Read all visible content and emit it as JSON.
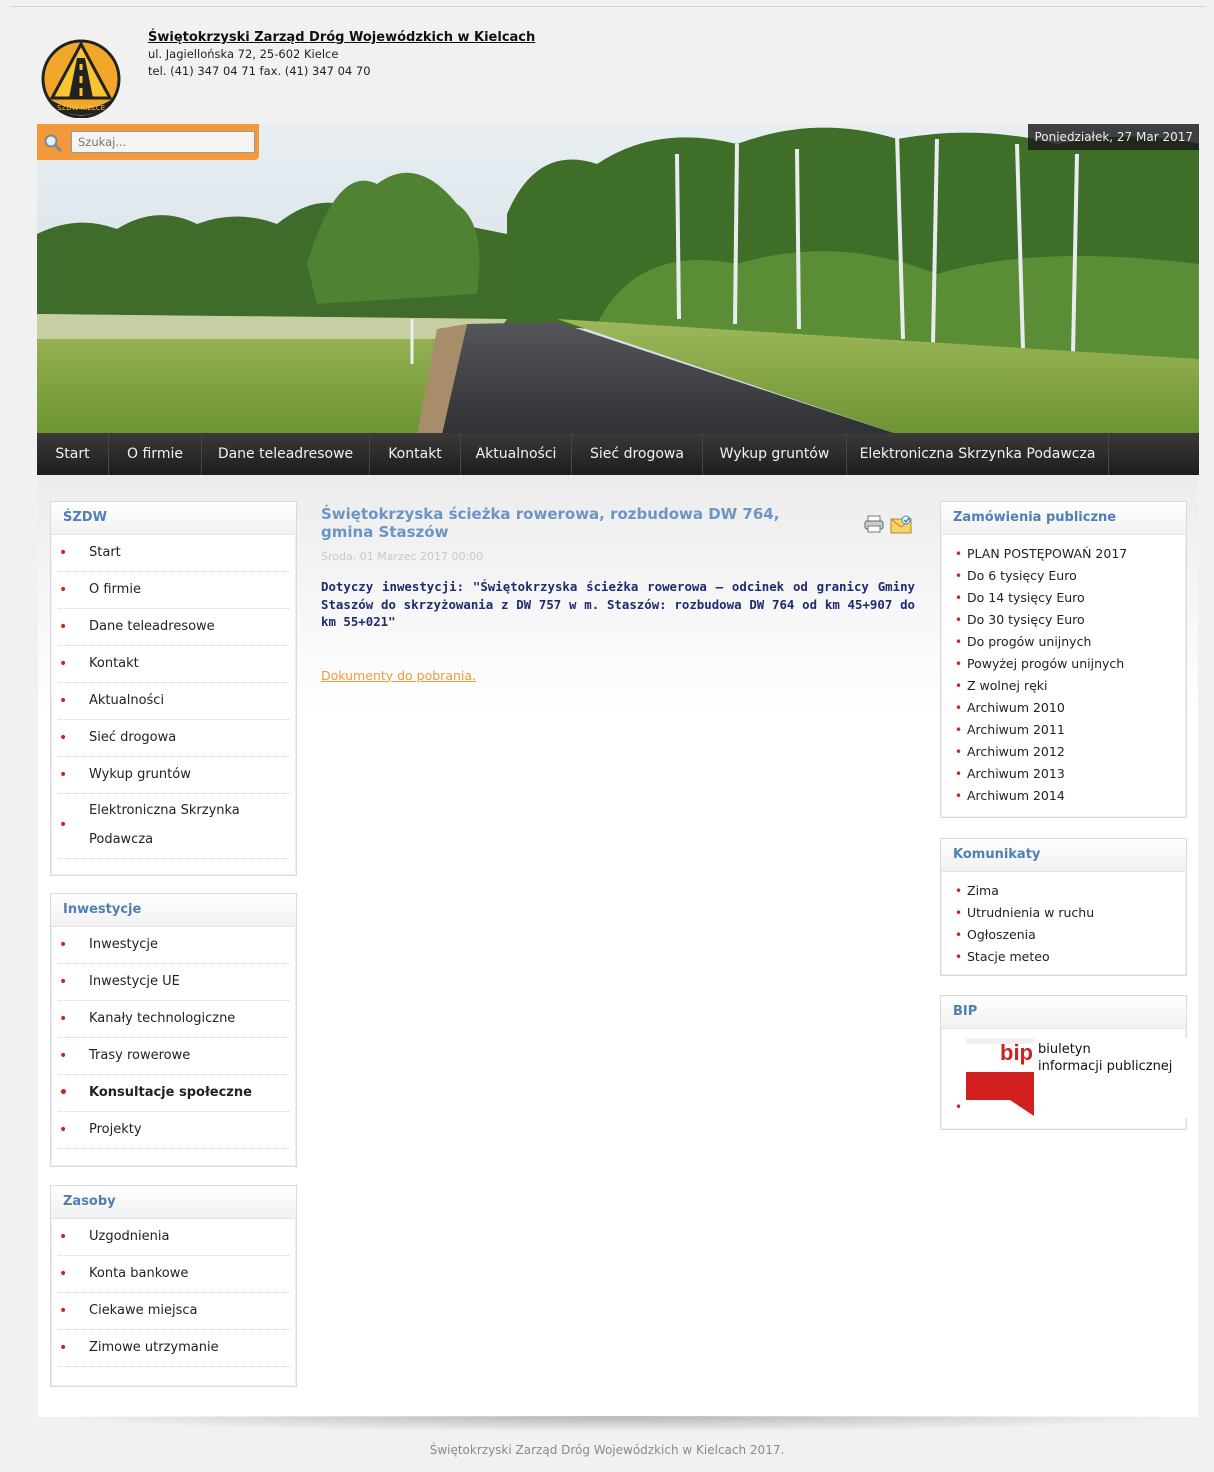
{
  "header": {
    "company_name": "Świętokrzyski Zarząd Dróg Wojewódzkich w Kielcach",
    "address": "ul. Jagiellońska 72, 25-602 Kielce",
    "phone": "tel. (41) 347 04 71 fax. (41) 347 04 70",
    "logo_text": "ŚZDW KIELCE"
  },
  "search": {
    "placeholder": "Szukaj..."
  },
  "date": "Poniedziałek, 27 Mar 2017",
  "nav": [
    "Start",
    "O firmie",
    "Dane teleadresowe",
    "Kontakt",
    "Aktualności",
    "Sieć drogowa",
    "Wykup gruntów",
    "Elektroniczna Skrzynka Podawcza"
  ],
  "left": {
    "szdw": {
      "title": "ŚZDW",
      "items": [
        "Start",
        "O firmie",
        "Dane teleadresowe",
        "Kontakt",
        "Aktualności",
        "Sieć drogowa",
        "Wykup gruntów",
        "Elektroniczna Skrzynka Podawcza"
      ]
    },
    "inwestycje": {
      "title": "Inwestycje",
      "items": [
        "Inwestycje",
        "Inwestycje UE",
        "Kanały technologiczne",
        "Trasy rowerowe",
        "Konsultacje społeczne",
        "Projekty"
      ]
    },
    "zasoby": {
      "title": "Zasoby",
      "items": [
        "Uzgodnienia",
        "Konta bankowe",
        "Ciekawe miejsca",
        "Zimowe utrzymanie"
      ]
    }
  },
  "article": {
    "title": "Świętokrzyska ścieżka rowerowa, rozbudowa DW 764, gmina Staszów",
    "meta": "Środa, 01 Marzec 2017 00:00",
    "body": "Dotyczy inwestycji: \"Świętokrzyska ścieżka rowerowa – odcinek od granicy Gminy Staszów do skrzyżowania z DW 757 w m. Staszów: rozbudowa DW 764 od km 45+907 do km 55+021\"",
    "link": "Dokumenty do pobrania."
  },
  "right": {
    "zamowienia": {
      "title": "Zamówienia publiczne",
      "items": [
        "PLAN POSTĘPOWAŃ 2017",
        "Do 6 tysięcy Euro",
        "Do 14 tysięcy Euro",
        "Do 30 tysięcy Euro",
        "Do progów unijnych",
        "Powyżej progów unijnych",
        "Z wolnej ręki",
        "Archiwum 2010",
        "Archiwum 2011",
        "Archiwum 2012",
        "Archiwum 2013",
        "Archiwum 2014"
      ]
    },
    "komunikaty": {
      "title": "Komunikaty",
      "items": [
        "Zima",
        "Utrudnienia w ruchu",
        "Ogłoszenia",
        "Stacje meteo"
      ]
    },
    "bip": {
      "title": "BIP",
      "logo_mark": "bip",
      "logo_line1": "biuletyn",
      "logo_line2": "informacji publicznej"
    }
  },
  "footer": "Świętokrzyski Zarząd Dróg Wojewódzkich w Kielcach 2017."
}
